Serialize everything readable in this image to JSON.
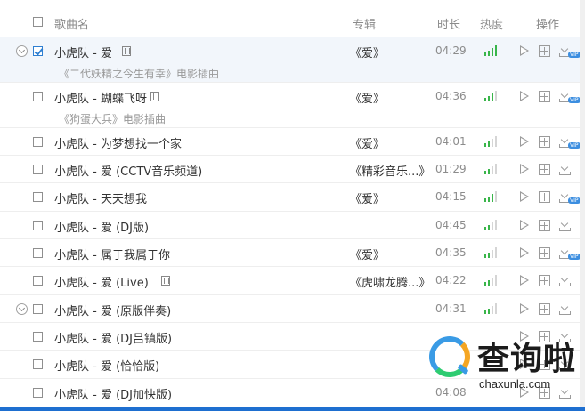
{
  "header": {
    "col_title": "歌曲名",
    "col_album": "专辑",
    "col_duration": "时长",
    "col_heat": "热度",
    "col_actions": "操作"
  },
  "songs": [
    {
      "title": "小虎队 - 爱",
      "subtitle": "《二代妖精之今生有幸》电影插曲",
      "album": "《爱》",
      "duration": "04:29",
      "heat": 4,
      "checked": true,
      "expandable": true,
      "has_mv": true,
      "vip": true
    },
    {
      "title": "小虎队 - 蝴蝶飞呀",
      "subtitle": "《狗蛋大兵》电影插曲",
      "album": "《爱》",
      "duration": "04:36",
      "heat": 3,
      "checked": false,
      "expandable": false,
      "has_mv": true,
      "vip": true
    },
    {
      "title": "小虎队 - 为梦想找一个家",
      "subtitle": "",
      "album": "《爱》",
      "duration": "04:01",
      "heat": 2,
      "checked": false,
      "expandable": false,
      "has_mv": false,
      "vip": true
    },
    {
      "title": "小虎队 - 爱 (CCTV音乐频道)",
      "subtitle": "",
      "album": "《精彩音乐...》",
      "duration": "01:29",
      "heat": 2,
      "checked": false,
      "expandable": false,
      "has_mv": false,
      "vip": false
    },
    {
      "title": "小虎队 - 天天想我",
      "subtitle": "",
      "album": "《爱》",
      "duration": "04:15",
      "heat": 3,
      "checked": false,
      "expandable": false,
      "has_mv": false,
      "vip": true
    },
    {
      "title": "小虎队 - 爱 (DJ版)",
      "subtitle": "",
      "album": "",
      "duration": "04:45",
      "heat": 2,
      "checked": false,
      "expandable": false,
      "has_mv": false,
      "vip": false
    },
    {
      "title": "小虎队 - 属于我属于你",
      "subtitle": "",
      "album": "《爱》",
      "duration": "04:35",
      "heat": 2,
      "checked": false,
      "expandable": false,
      "has_mv": false,
      "vip": true
    },
    {
      "title": "小虎队 - 爱 (Live)",
      "subtitle": "",
      "album": "《虎啸龙腾...》",
      "duration": "04:22",
      "heat": 2,
      "checked": false,
      "expandable": false,
      "has_mv": true,
      "vip": false
    },
    {
      "title": "小虎队 - 爱 (原版伴奏)",
      "subtitle": "",
      "album": "",
      "duration": "04:31",
      "heat": 2,
      "checked": false,
      "expandable": true,
      "has_mv": false,
      "vip": false
    },
    {
      "title": "小虎队 - 爱 (DJ吕镇版)",
      "subtitle": "",
      "album": "",
      "duration": "",
      "heat": 0,
      "checked": false,
      "expandable": false,
      "has_mv": false,
      "vip": false
    },
    {
      "title": "小虎队 - 爱 (恰恰版)",
      "subtitle": "",
      "album": "",
      "duration": "",
      "heat": 0,
      "checked": false,
      "expandable": false,
      "has_mv": false,
      "vip": false
    },
    {
      "title": "小虎队 - 爱 (DJ加快版)",
      "subtitle": "",
      "album": "",
      "duration": "04:08",
      "heat": 0,
      "checked": false,
      "expandable": false,
      "has_mv": false,
      "vip": false
    }
  ],
  "icons": {
    "expand": "chevron-down-circle-icon",
    "mv": "film-icon",
    "play": "play-icon",
    "add": "add-to-list-icon",
    "download": "download-icon",
    "vip": "vip-badge"
  },
  "watermark": {
    "text": "查询啦",
    "url": "chaxunla.com",
    "vip_label": "VIP"
  },
  "colors": {
    "heat_on": "#39b54a",
    "heat_off": "#d5d5d5",
    "checkbox_checked": "#2f7fd1",
    "row_highlight": "#f2f6fb",
    "bottom_bar": "#1e6fd0"
  }
}
